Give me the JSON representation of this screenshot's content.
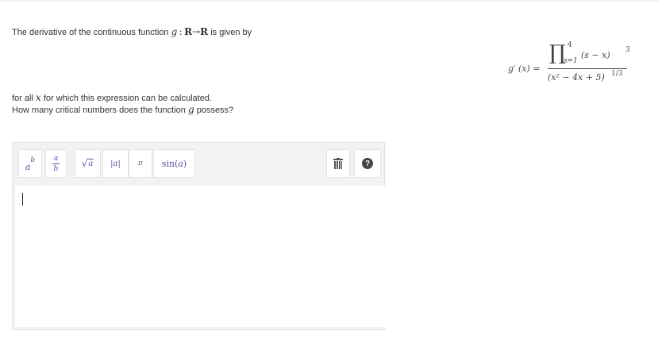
{
  "question": {
    "line1_prefix": "The derivative of the continuous function",
    "func_name": "g",
    "domain": "R",
    "arrow": "→",
    "codomain": "R",
    "line1_suffix": "is given by",
    "line2_prefix": "for all",
    "line2_var": "x",
    "line2_suffix": "for which this expression can be calculated.",
    "line3_prefix": "How many critical numbers does the function",
    "line3_var": "g",
    "line3_suffix": "possess?"
  },
  "formula": {
    "lhs_fn": "g",
    "lhs_prime": "′",
    "lhs_arg": "(x) =",
    "product_symbol": "∏",
    "product_upper": "4",
    "product_lower": "s=1",
    "numerator_body": "(s − x)",
    "numerator_exponent": "3",
    "denominator": "(x² − 4x + 5)",
    "denominator_exponent": "1/3"
  },
  "toolbar": {
    "power_base": "a",
    "power_exp": "b",
    "frac_num": "a",
    "frac_den": "b",
    "sqrt_symbol": "√",
    "sqrt_arg": "a",
    "abs_label": "|a|",
    "pi_label": "π",
    "sin_fn": "sin",
    "sin_open": "(",
    "sin_arg": "a",
    "sin_close": ")",
    "help_glyph": "?",
    "icons": [
      "trash-icon",
      "help-icon"
    ]
  },
  "colors": {
    "toolbar_symbol": "#5a4ea8",
    "editor_bg": "#f2f2f2",
    "text": "#333333"
  }
}
